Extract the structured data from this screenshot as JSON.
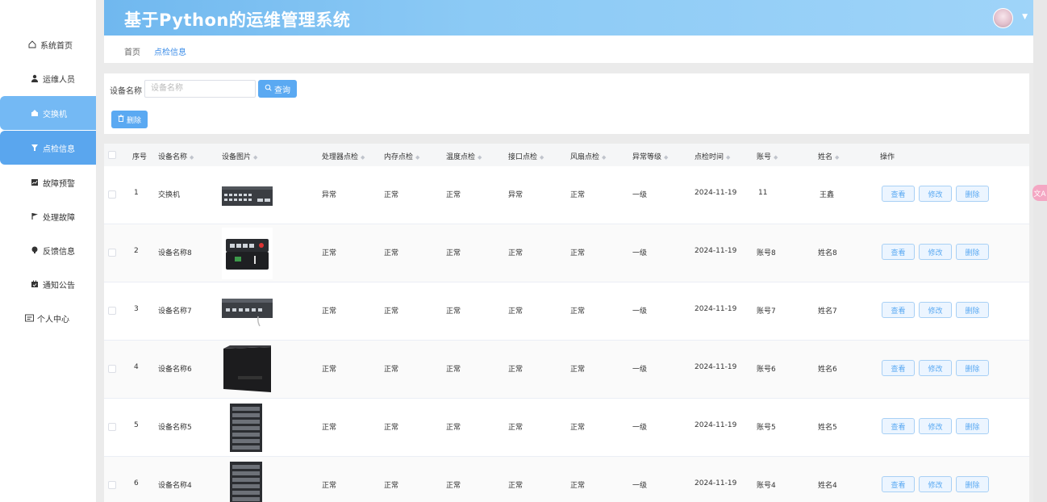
{
  "app": {
    "title": "基于Python的运维管理系统"
  },
  "sidebar": {
    "items": [
      {
        "label": "系统首页",
        "icon": "home-icon"
      },
      {
        "label": "运维人员",
        "icon": "user-icon"
      },
      {
        "label": "交换机",
        "icon": "switch-icon"
      },
      {
        "label": "点检信息",
        "icon": "inspect-icon"
      },
      {
        "label": "故障预警",
        "icon": "alert-icon"
      },
      {
        "label": "处理故障",
        "icon": "flag-icon"
      },
      {
        "label": "反馈信息",
        "icon": "feedback-icon"
      },
      {
        "label": "通知公告",
        "icon": "notice-icon"
      },
      {
        "label": "个人中心",
        "icon": "profile-icon"
      }
    ]
  },
  "breadcrumb": {
    "home": "首页",
    "current": "点检信息"
  },
  "search": {
    "label": "设备名称",
    "placeholder": "设备名称",
    "button": "查询"
  },
  "toolbar": {
    "delete": "删除"
  },
  "table": {
    "headers": [
      "序号",
      "设备名称",
      "设备图片",
      "处理器点检",
      "内存点检",
      "温度点检",
      "接口点检",
      "风扇点检",
      "异常等级",
      "点检时间",
      "账号",
      "姓名",
      "操作"
    ],
    "rows": [
      {
        "no": "1",
        "name": "交换机",
        "cpu": "异常",
        "mem": "正常",
        "temp": "正常",
        "port": "异常",
        "fan": "正常",
        "level": "一级",
        "time": "2024-11-19",
        "account": "11",
        "person": "王鑫"
      },
      {
        "no": "2",
        "name": "设备名称8",
        "cpu": "正常",
        "mem": "正常",
        "temp": "正常",
        "port": "正常",
        "fan": "正常",
        "level": "一级",
        "time": "2024-11-19",
        "account": "账号8",
        "person": "姓名8"
      },
      {
        "no": "3",
        "name": "设备名称7",
        "cpu": "正常",
        "mem": "正常",
        "temp": "正常",
        "port": "正常",
        "fan": "正常",
        "level": "一级",
        "time": "2024-11-19",
        "account": "账号7",
        "person": "姓名7"
      },
      {
        "no": "4",
        "name": "设备名称6",
        "cpu": "正常",
        "mem": "正常",
        "temp": "正常",
        "port": "正常",
        "fan": "正常",
        "level": "一级",
        "time": "2024-11-19",
        "account": "账号6",
        "person": "姓名6"
      },
      {
        "no": "5",
        "name": "设备名称5",
        "cpu": "正常",
        "mem": "正常",
        "temp": "正常",
        "port": "正常",
        "fan": "正常",
        "level": "一级",
        "time": "2024-11-19",
        "account": "账号5",
        "person": "姓名5"
      },
      {
        "no": "6",
        "name": "设备名称4",
        "cpu": "正常",
        "mem": "正常",
        "temp": "正常",
        "port": "正常",
        "fan": "正常",
        "level": "一级",
        "time": "2024-11-19",
        "account": "账号4",
        "person": "姓名4"
      }
    ],
    "actions": {
      "view": "查看",
      "edit": "修改",
      "delete": "删除"
    }
  },
  "colors": {
    "primary": "#5aa9f2",
    "header": "#70b8ef",
    "active_menu": "#74b9f4"
  }
}
